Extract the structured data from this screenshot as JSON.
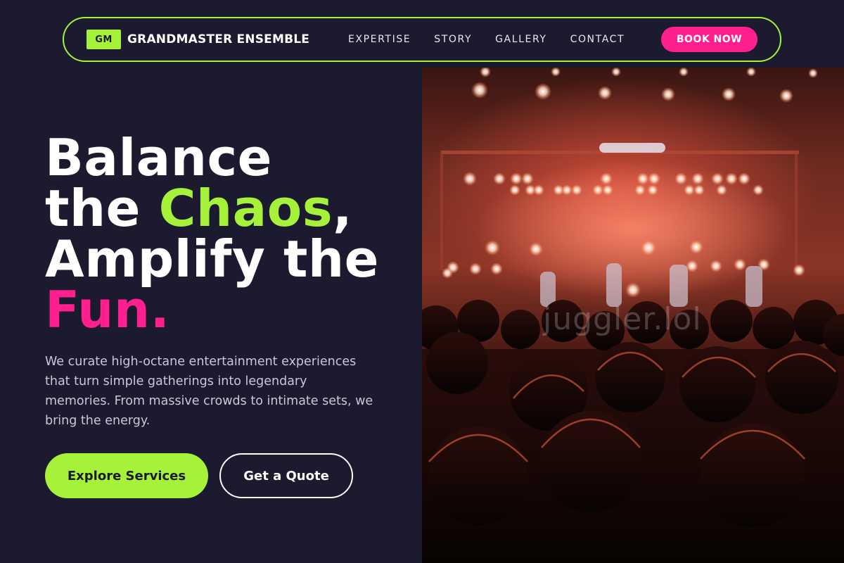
{
  "brand": {
    "logo": "GM",
    "name": "GRANDMASTER ENSEMBLE"
  },
  "nav": {
    "links": [
      "EXPERTISE",
      "STORY",
      "GALLERY",
      "CONTACT"
    ],
    "cta": "BOOK NOW"
  },
  "hero": {
    "title_line1": "Balance",
    "title_line2_prefix": "the ",
    "title_line2_accent": "Chaos",
    "title_line2_suffix": ",",
    "title_line3": "Amplify the",
    "title_line4_accent": "Fun.",
    "description": "We curate high-octane entertainment experiences that turn simple gatherings into legendary memories. From massive crowds to intimate sets, we bring the energy.",
    "primary_button": "Explore Services",
    "secondary_button": "Get a Quote"
  },
  "photo": {
    "watermark": "juggler.lol",
    "subject": "concert-crowd-photo"
  },
  "colors": {
    "background": "#1b1a2e",
    "accent_green": "#a6f23a",
    "accent_pink": "#ff1f8e",
    "text": "#ffffff",
    "muted_text": "#c9c8d8"
  }
}
